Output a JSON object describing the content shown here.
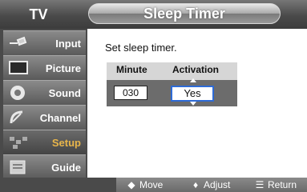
{
  "header": {
    "tv_label": "TV",
    "title": "Sleep Timer"
  },
  "sidebar": {
    "items": [
      {
        "label": "Input",
        "icon": "input-plug-icon",
        "active": false
      },
      {
        "label": "Picture",
        "icon": "picture-screen-icon",
        "active": false
      },
      {
        "label": "Sound",
        "icon": "speaker-icon",
        "active": false
      },
      {
        "label": "Channel",
        "icon": "satellite-dish-icon",
        "active": false
      },
      {
        "label": "Setup",
        "icon": "setup-grid-icon",
        "active": true
      },
      {
        "label": "Guide",
        "icon": "guide-book-icon",
        "active": false
      }
    ]
  },
  "content": {
    "instruction": "Set sleep timer.",
    "columns": {
      "minute": "Minute",
      "activation": "Activation"
    },
    "values": {
      "minute": "030",
      "activation": "Yes"
    }
  },
  "footer": {
    "move_label": "Move",
    "adjust_label": "Adjust",
    "return_label": "Return",
    "move_icon": "◆",
    "adjust_icon": "♦",
    "return_icon": "☰"
  },
  "colors": {
    "active_sidebar_label": "#e8b54a",
    "selection_outline": "#2e6bd6",
    "header_pill": "#a8a8a8"
  }
}
